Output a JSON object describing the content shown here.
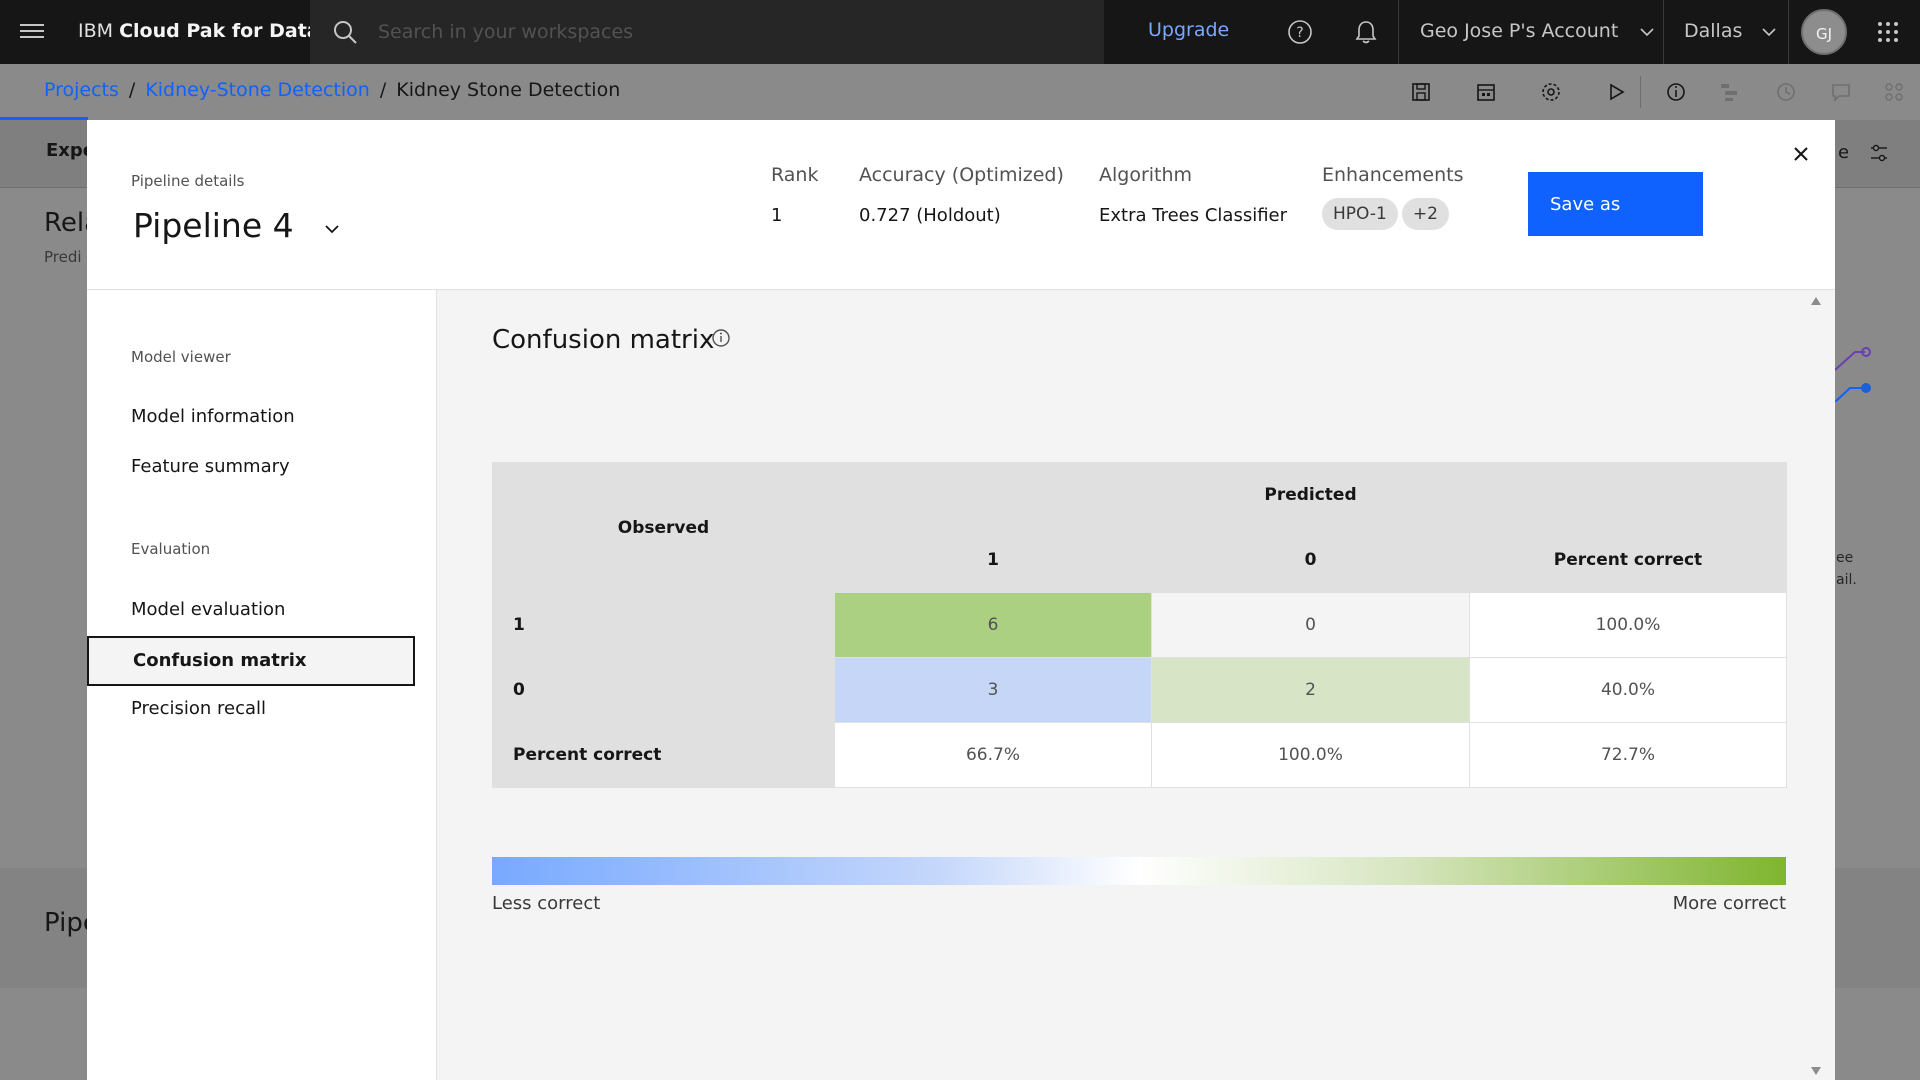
{
  "topbar": {
    "brand_prefix": "IBM",
    "brand_name": "Cloud Pak for Data",
    "search_placeholder": "Search in your workspaces",
    "upgrade_label": "Upgrade",
    "account_label": "Geo Jose P's Account",
    "region_label": "Dallas",
    "avatar_initials": "GJ"
  },
  "breadcrumb": {
    "items": [
      "Projects",
      "Kidney-Stone Detection"
    ],
    "current": "Kidney Stone Detection",
    "separator": "/"
  },
  "background_page": {
    "tab_text": "Expe",
    "heading_text": "Rela",
    "subheading_text": "Predi",
    "right_text_1": "e",
    "right_text_2": "ee",
    "right_text_3": "ail.",
    "bottom_text": "Pipe"
  },
  "modal": {
    "pipeline_label": "Pipeline details",
    "pipeline_name": "Pipeline 4",
    "rank": {
      "label": "Rank",
      "value": "1"
    },
    "accuracy": {
      "label": "Accuracy  (Optimized)",
      "value": "0.727 (Holdout)"
    },
    "algorithm": {
      "label": "Algorithm",
      "value": "Extra Trees Classifier"
    },
    "enhancements": {
      "label": "Enhancements",
      "tags": [
        "HPO-1",
        "+2"
      ]
    },
    "save_label": "Save as"
  },
  "left_panel": {
    "sections": [
      {
        "heading": "Model viewer",
        "items": [
          "Model information",
          "Feature summary"
        ]
      },
      {
        "heading": "Evaluation",
        "items": [
          "Model evaluation",
          "Confusion matrix",
          "Precision recall"
        ]
      }
    ],
    "selected": "Confusion matrix"
  },
  "confusion_matrix": {
    "title": "Confusion matrix",
    "observed_label": "Observed",
    "predicted_label": "Predicted",
    "columns": [
      "1",
      "0",
      "Percent correct"
    ],
    "rows": [
      {
        "label": "1",
        "cells": [
          "6",
          "0",
          "100.0%"
        ]
      },
      {
        "label": "0",
        "cells": [
          "3",
          "2",
          "40.0%"
        ]
      },
      {
        "label": "Percent correct",
        "cells": [
          "66.7%",
          "100.0%",
          "72.7%"
        ]
      }
    ],
    "colors": {
      "strong_correct": "#acd082",
      "light_correct": "#d7e4c6",
      "incorrect": "#c5d6f6",
      "neutral": "#f4f4f4",
      "white": "#ffffff"
    },
    "legend_less": "Less correct",
    "legend_more": "More correct"
  },
  "colors": {
    "accent": "#0f62fe",
    "topbar_bg": "#161616",
    "link": "#0f62fe"
  }
}
